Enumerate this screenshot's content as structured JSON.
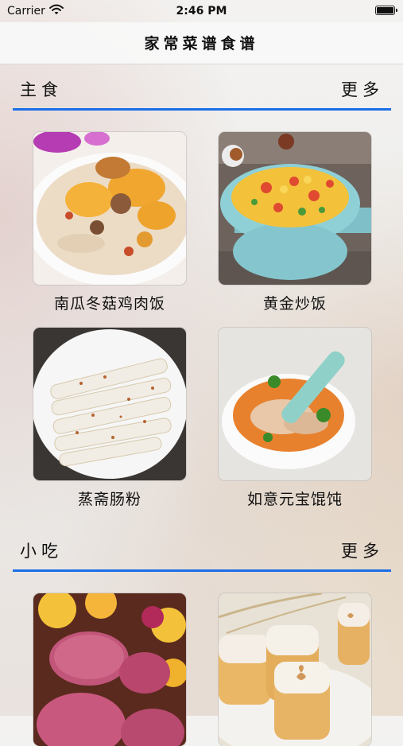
{
  "status_bar": {
    "carrier": "Carrier",
    "time": "2:46 PM"
  },
  "nav": {
    "title": "家常菜谱食谱"
  },
  "sections": [
    {
      "title": "主食",
      "more": "更多",
      "items": [
        {
          "name": "南瓜冬菇鸡肉饭"
        },
        {
          "name": "黄金炒饭"
        },
        {
          "name": "蒸斋肠粉"
        },
        {
          "name": "如意元宝馄饨"
        }
      ]
    },
    {
      "title": "小吃",
      "more": "更多",
      "items": [
        {},
        {}
      ]
    }
  ],
  "colors": {
    "accent": "#1b6ee8",
    "nav_bg": "#f8f8f8"
  }
}
